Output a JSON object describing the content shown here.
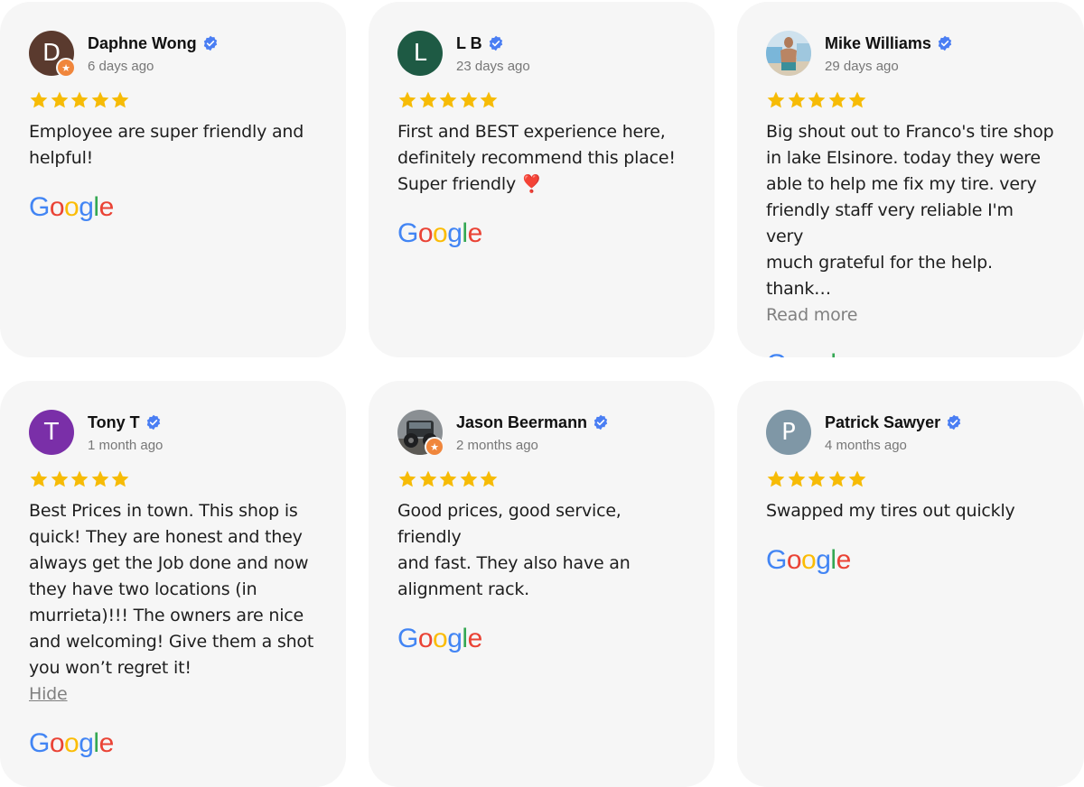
{
  "colors": {
    "card_bg": "#f6f6f6",
    "star": "#f6bb06",
    "verified": "#4a7ef3",
    "avatar_daphne": "#5a3a2e",
    "avatar_lb": "#1e5a44",
    "avatar_tony": "#7a2fa8",
    "avatar_patrick": "#7f97a6",
    "google_blue": "#4285F4",
    "google_red": "#EA4335",
    "google_yellow": "#FBBC05",
    "google_green": "#34A853"
  },
  "reviews": [
    {
      "initial": "D",
      "name": "Daphne Wong",
      "date": "6 days ago",
      "rating": 5,
      "lines": [
        "Employee are super friendly and",
        "helpful!"
      ],
      "icon": "google-logo"
    },
    {
      "initial": "L",
      "name": "L B",
      "date": "23 days ago",
      "rating": 5,
      "lines": [
        "First and BEST experience here,",
        "definitely recommend this place!",
        "Super friendly ❣️"
      ],
      "icon": "google-logo"
    },
    {
      "initial": "",
      "name": "Mike Williams",
      "date": "29 days ago",
      "rating": 5,
      "lines": [
        "Big shout out to Franco's tire shop",
        "in lake Elsinore. today they were",
        "able to help me fix my tire. very",
        "friendly staff very reliable I'm very",
        "much grateful for the help. thank…"
      ],
      "link": "Read more",
      "icon": "google-logo"
    },
    {
      "initial": "T",
      "name": "Tony T",
      "date": "1 month ago",
      "rating": 5,
      "lines": [
        "Best Prices in town. This shop is",
        "quick! They are honest and they",
        "always get the Job done and now",
        "they have two locations (in",
        "murrieta)!!! The owners are nice",
        "and welcoming! Give them a shot",
        "you won’t regret it!"
      ],
      "link": "Hide",
      "icon": "google-logo"
    },
    {
      "initial": "",
      "name": "Jason Beermann",
      "date": "2 months ago",
      "rating": 5,
      "lines": [
        "Good prices, good service, friendly",
        "and fast. They also have an",
        "alignment rack."
      ],
      "icon": "google-logo"
    },
    {
      "initial": "P",
      "name": "Patrick Sawyer",
      "date": "4 months ago",
      "rating": 5,
      "lines": [
        "Swapped my tires out quickly"
      ],
      "icon": "google-logo"
    }
  ]
}
